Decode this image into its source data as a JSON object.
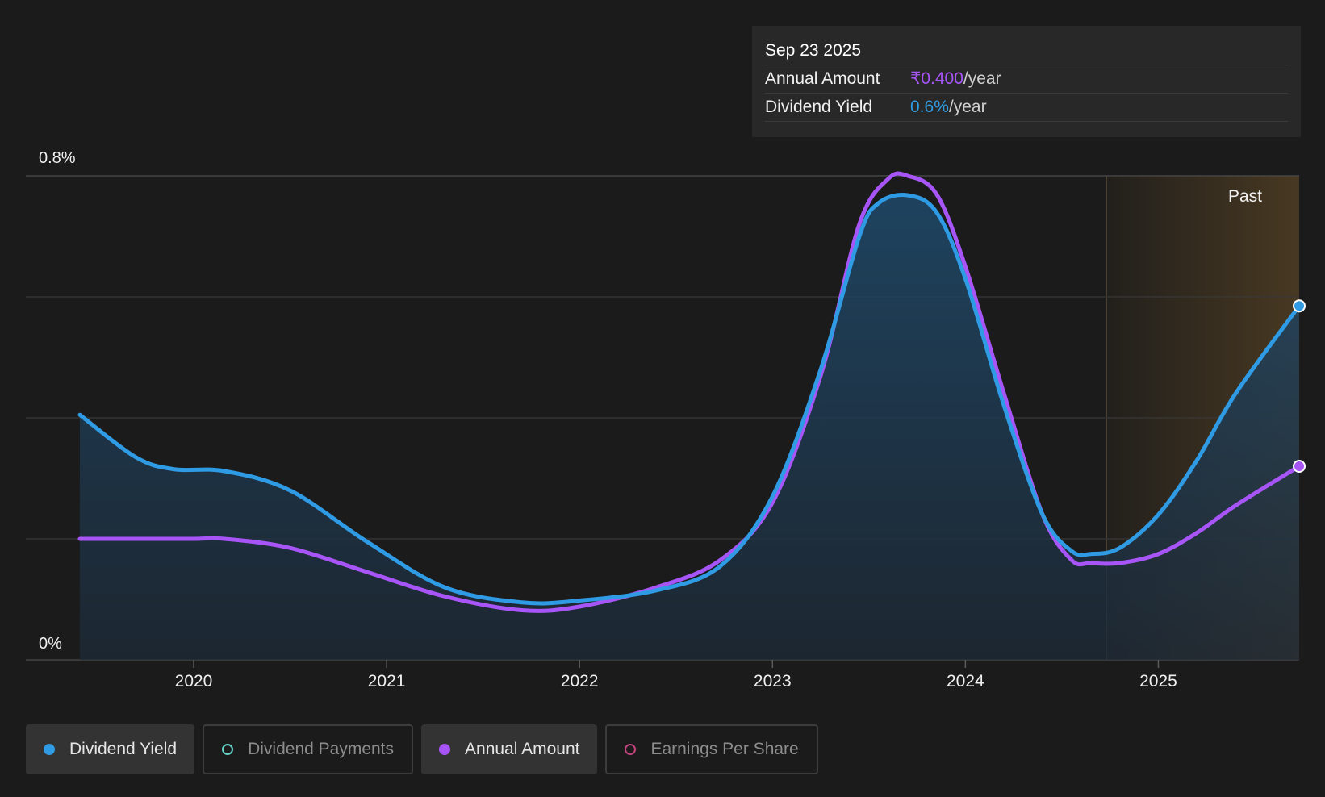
{
  "colors": {
    "background": "#1b1b1b",
    "dividend_yield": "#2f9be4",
    "annual_amount": "#a855f7",
    "dividend_payments": "#5fd3c4",
    "earnings_per_share": "#c2447d",
    "past_region": "#4a3a22"
  },
  "tooltip": {
    "date": "Sep 23 2025",
    "annual_label": "Annual Amount",
    "annual_value": "₹0.400",
    "annual_unit": "/year",
    "yield_label": "Dividend Yield",
    "yield_value": "0.6%",
    "yield_unit": "/year"
  },
  "legend": [
    {
      "label": "Dividend Yield",
      "color": "#2f9be4",
      "active": true,
      "icon": "filled-dot-icon"
    },
    {
      "label": "Dividend Payments",
      "color": "#5fd3c4",
      "active": false,
      "icon": "hollow-dot-icon"
    },
    {
      "label": "Annual Amount",
      "color": "#a855f7",
      "active": true,
      "icon": "filled-dot-icon"
    },
    {
      "label": "Earnings Per Share",
      "color": "#c2447d",
      "active": false,
      "icon": "hollow-dot-icon"
    }
  ],
  "chart_data": {
    "type": "area",
    "y_tick_labels": [
      "0%",
      "0.8%"
    ],
    "ylim": [
      0,
      0.8
    ],
    "xlim": [
      2019.13,
      2025.73
    ],
    "x_ticks": [
      2020,
      2021,
      2022,
      2023,
      2024,
      2025
    ],
    "past_label": "Past",
    "past_start": 2024.73,
    "grid": true,
    "series": [
      {
        "name": "Dividend Yield",
        "color": "#2f9be4",
        "x": [
          2019.41,
          2019.7,
          2019.9,
          2020.16,
          2020.5,
          2020.9,
          2021.3,
          2021.7,
          2022.0,
          2022.4,
          2022.73,
          2023.0,
          2023.25,
          2023.45,
          2023.55,
          2023.7,
          2023.85,
          2024.0,
          2024.2,
          2024.4,
          2024.55,
          2024.65,
          2024.8,
          2025.0,
          2025.2,
          2025.4,
          2025.73
        ],
        "y": [
          0.405,
          0.335,
          0.315,
          0.312,
          0.28,
          0.195,
          0.12,
          0.095,
          0.098,
          0.115,
          0.155,
          0.27,
          0.48,
          0.7,
          0.755,
          0.768,
          0.74,
          0.63,
          0.42,
          0.24,
          0.18,
          0.175,
          0.185,
          0.24,
          0.33,
          0.44,
          0.585
        ]
      },
      {
        "name": "Annual Amount",
        "color": "#a855f7",
        "x": [
          2019.41,
          2019.7,
          2020.0,
          2020.16,
          2020.5,
          2020.9,
          2021.3,
          2021.7,
          2022.0,
          2022.4,
          2022.73,
          2023.0,
          2023.25,
          2023.45,
          2023.6,
          2023.7,
          2023.85,
          2024.0,
          2024.2,
          2024.4,
          2024.55,
          2024.65,
          2024.8,
          2025.0,
          2025.2,
          2025.4,
          2025.73
        ],
        "y": [
          0.2,
          0.2,
          0.2,
          0.2,
          0.185,
          0.145,
          0.105,
          0.082,
          0.088,
          0.12,
          0.165,
          0.26,
          0.47,
          0.72,
          0.795,
          0.8,
          0.77,
          0.65,
          0.44,
          0.24,
          0.165,
          0.16,
          0.16,
          0.175,
          0.21,
          0.255,
          0.32
        ]
      }
    ]
  }
}
